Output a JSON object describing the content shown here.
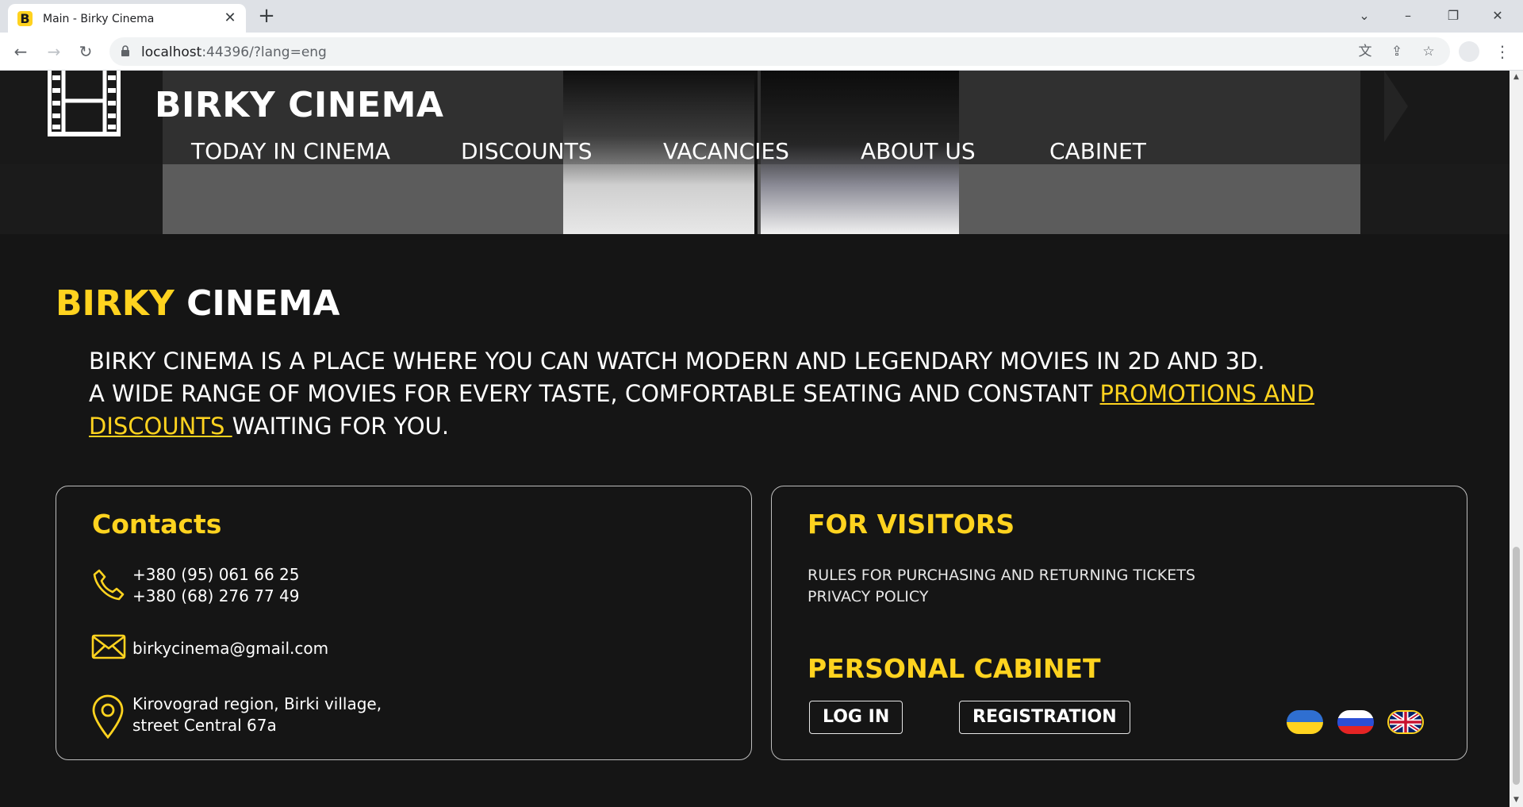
{
  "browser": {
    "tab_title": "Main - Birky Cinema",
    "favicon_letter": "B",
    "url_host": "localhost",
    "url_rest": ":44396/?lang=eng"
  },
  "header": {
    "brand": "BIRKY CINEMA",
    "nav": [
      "TODAY IN CINEMA",
      "DISCOUNTS",
      "VACANCIES",
      "ABOUT US",
      "CABINET"
    ]
  },
  "about": {
    "title_accent": "BIRKY",
    "title_rest": " CINEMA",
    "line1": "BIRKY CINEMA IS A PLACE WHERE YOU CAN WATCH MODERN AND LEGENDARY MOVIES IN 2D AND 3D.",
    "line2_start": "A WIDE RANGE OF MOVIES FOR EVERY TASTE, COMFORTABLE SEATING AND CONSTANT ",
    "link": "PROMOTIONS AND DISCOUNTS ",
    "line2_end": "WAITING FOR YOU."
  },
  "contacts": {
    "title": "Contacts",
    "phone1": "+380 (95) 061 66 25",
    "phone2": "+380 (68) 276 77 49",
    "email": "birkycinema@gmail.com",
    "address1": "Kirovograd region, Birki village,",
    "address2": "street Central 67a"
  },
  "visitors": {
    "title": "FOR VISITORS",
    "links": [
      "RULES FOR PURCHASING AND RETURNING TICKETS",
      "PRIVACY POLICY"
    ],
    "cabinet_title": "PERSONAL CABINET",
    "login": "LOG IN",
    "registration": "REGISTRATION"
  },
  "colors": {
    "accent": "#ffd31f",
    "background": "#151515"
  },
  "languages": [
    "ukrainian-flag",
    "russian-flag",
    "uk-flag"
  ]
}
